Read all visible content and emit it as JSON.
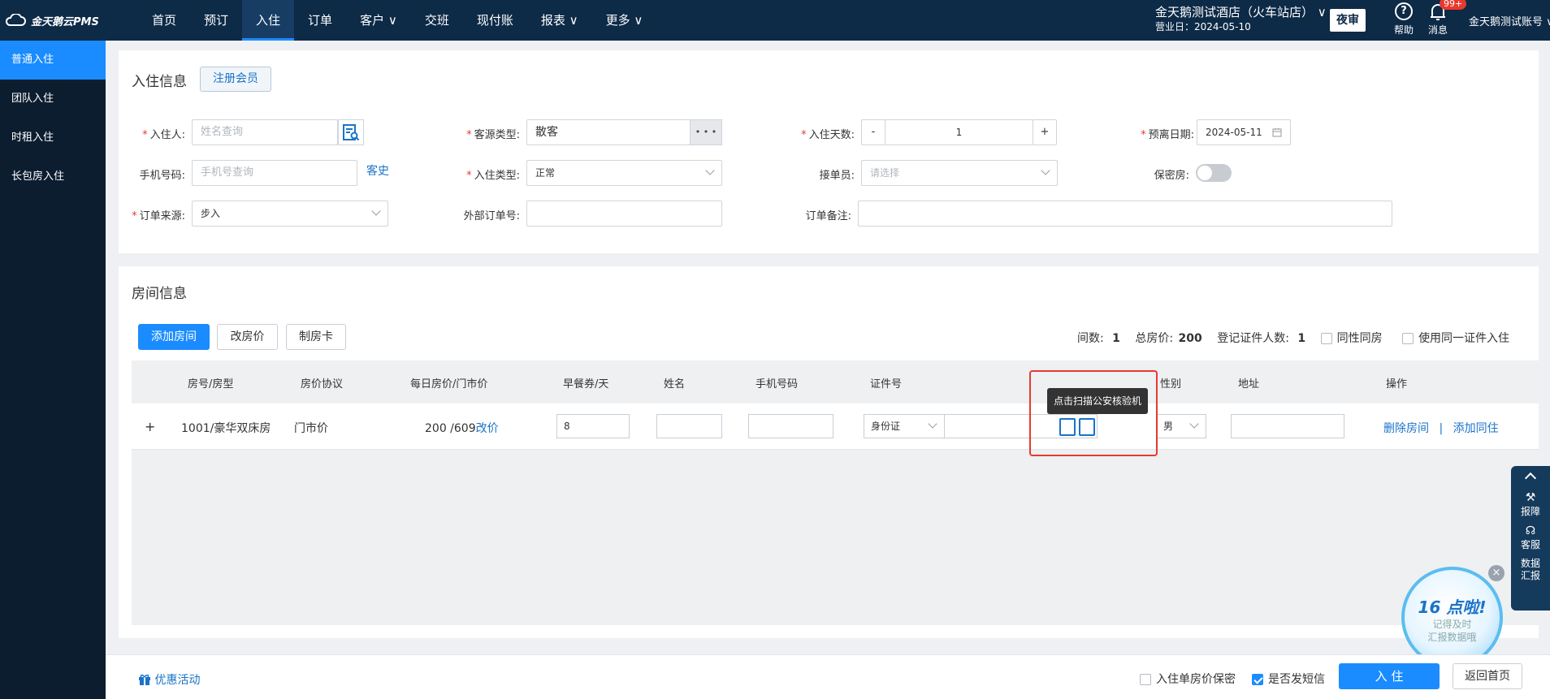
{
  "app": {
    "logo_text": "金天鹅云PMS"
  },
  "nav": {
    "items": [
      {
        "label": "首页"
      },
      {
        "label": "预订"
      },
      {
        "label": "入住"
      },
      {
        "label": "订单"
      },
      {
        "label": "客户 ∨"
      },
      {
        "label": "交班"
      },
      {
        "label": "现付账"
      },
      {
        "label": "报表 ∨"
      },
      {
        "label": "更多 ∨"
      }
    ],
    "active_index": 2
  },
  "header": {
    "hotel_name": "金天鹅测试酒店（火车站店） ∨",
    "business_day": "营业日：2024-05-10",
    "night_audit": "夜审",
    "help": "帮助",
    "messages": "消息",
    "message_badge": "99+",
    "account": "金天鹅测试账号 ∨"
  },
  "sidebar": {
    "items": [
      {
        "label": "普通入住"
      },
      {
        "label": "团队入住"
      },
      {
        "label": "时租入住"
      },
      {
        "label": "长包房入住"
      }
    ],
    "active_index": 0
  },
  "checkin": {
    "title": "入住信息",
    "register_member": "注册会员",
    "guest_label": "入住人:",
    "guest_placeholder": "姓名查询",
    "source_type_label": "客源类型:",
    "source_type_value": "散客",
    "more_dots": "• • •",
    "days_label": "入住天数:",
    "days_minus": "-",
    "days_value": "1",
    "days_plus": "+",
    "departure_label": "预离日期:",
    "departure_value": "2024-05-11",
    "phone_label": "手机号码:",
    "phone_placeholder": "手机号查询",
    "guest_history": "客史",
    "checkin_type_label": "入住类型:",
    "checkin_type_value": "正常",
    "receiver_label": "接单员:",
    "receiver_placeholder": "请选择",
    "secret_room_label": "保密房:",
    "order_source_label": "订单来源:",
    "order_source_value": "步入",
    "external_order_label": "外部订单号:",
    "order_note_label": "订单备注:"
  },
  "rooms": {
    "title": "房间信息",
    "add_room": "添加房间",
    "change_price": "改房价",
    "make_card": "制房卡",
    "summary": {
      "rooms_label": "间数:",
      "rooms_value": "1",
      "total_label": "总房价:",
      "total_value": "200",
      "id_count_label": "登记证件人数:",
      "id_count_value": "1",
      "same_gender": "同性同房",
      "same_id": "使用同一证件入住"
    },
    "columns": [
      "房号/房型",
      "房价协议",
      "每日房价/门市价",
      "早餐券/天",
      "姓名",
      "手机号码",
      "证件号",
      "性别",
      "地址",
      "操作"
    ],
    "row": {
      "expand": "+",
      "room": "1001/豪华双床房",
      "agreement": "门市价",
      "price": "200 /609",
      "change_link": "改价",
      "breakfast": "8",
      "id_type": "身份证",
      "gender": "男",
      "delete_room": "删除房间",
      "separator": "|",
      "add_guest": "添加同住"
    },
    "tooltip": "点击扫描公安核验机"
  },
  "float": {
    "report_issue": "报障",
    "service": "客服",
    "data_report": "数据汇报",
    "bubble_title": "16 点啦!",
    "bubble_text1": "记得及时",
    "bubble_text2": "汇报数据哦",
    "close": "×"
  },
  "footer": {
    "promotions": "优惠活动",
    "price_secret": "入住单房价保密",
    "send_sms": "是否发短信",
    "checkin_button": "入 住",
    "back_home": "返回首页"
  }
}
